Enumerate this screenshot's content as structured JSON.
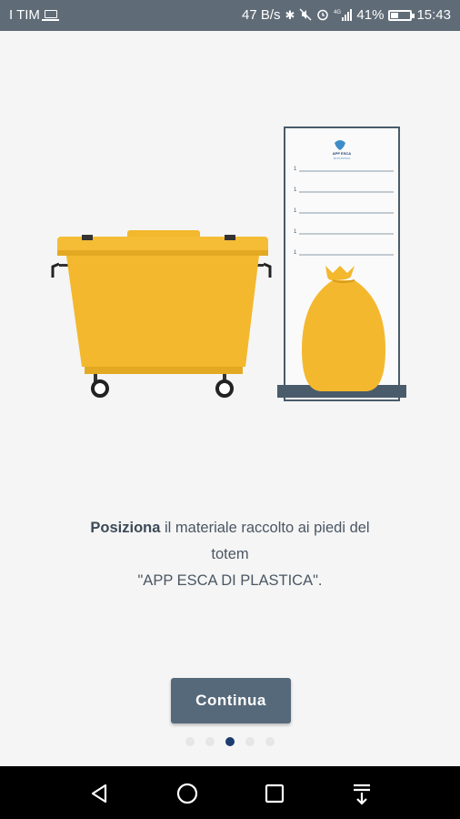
{
  "status_bar": {
    "carrier": "I TIM",
    "net_speed": "47 B/s",
    "network": "4G",
    "battery": "41%",
    "battery_level": 0.41,
    "time": "15:43"
  },
  "illustration": {
    "totem_logo_line1": "APP ESCA",
    "totem_logo_line2": "DI PLASTICA",
    "totem_rows": [
      "1",
      "1",
      "1",
      "1",
      "1"
    ]
  },
  "message": {
    "highlight": "Posiziona",
    "line1_rest": " il materiale raccolto ai piedi del",
    "line2": "totem",
    "line3": "\"APP ESCA DI PLASTICA\"."
  },
  "buttons": {
    "continue_label": "Continua"
  },
  "pager": {
    "count": 5,
    "active_index": 2
  },
  "colors": {
    "status_bar": "#5f6b76",
    "bin_yellow": "#f3b82d",
    "button": "#56697a",
    "active_dot": "#1d3c72"
  },
  "navigation_bar": {
    "icons": [
      "back-icon",
      "home-icon",
      "recents-icon",
      "notifications-pull-icon"
    ]
  }
}
